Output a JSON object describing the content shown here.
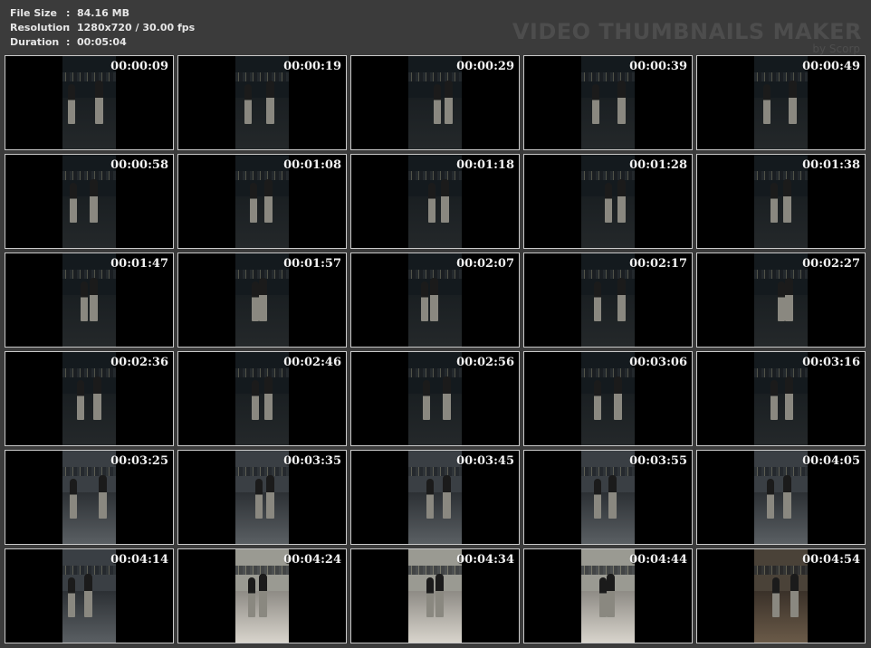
{
  "info": {
    "file_size_label": "File Size",
    "file_size_value": "84.16 MB",
    "resolution_label": "Resolution",
    "resolution_value": "1280x720 / 30.00 fps",
    "duration_label": "Duration",
    "duration_value": "00:05:04",
    "separator": ":"
  },
  "brand": {
    "title": "VIDEO THUMBNAILS MAKER",
    "subtitle": "by Scorp"
  },
  "thumbnails": [
    {
      "timestamp": "00:00:09"
    },
    {
      "timestamp": "00:00:19"
    },
    {
      "timestamp": "00:00:29"
    },
    {
      "timestamp": "00:00:39"
    },
    {
      "timestamp": "00:00:49"
    },
    {
      "timestamp": "00:00:58"
    },
    {
      "timestamp": "00:01:08"
    },
    {
      "timestamp": "00:01:18"
    },
    {
      "timestamp": "00:01:28"
    },
    {
      "timestamp": "00:01:38"
    },
    {
      "timestamp": "00:01:47"
    },
    {
      "timestamp": "00:01:57"
    },
    {
      "timestamp": "00:02:07"
    },
    {
      "timestamp": "00:02:17"
    },
    {
      "timestamp": "00:02:27"
    },
    {
      "timestamp": "00:02:36"
    },
    {
      "timestamp": "00:02:46"
    },
    {
      "timestamp": "00:02:56"
    },
    {
      "timestamp": "00:03:06"
    },
    {
      "timestamp": "00:03:16"
    },
    {
      "timestamp": "00:03:25"
    },
    {
      "timestamp": "00:03:35"
    },
    {
      "timestamp": "00:03:45"
    },
    {
      "timestamp": "00:03:55"
    },
    {
      "timestamp": "00:04:05"
    },
    {
      "timestamp": "00:04:14"
    },
    {
      "timestamp": "00:04:24"
    },
    {
      "timestamp": "00:04:34"
    },
    {
      "timestamp": "00:04:44"
    },
    {
      "timestamp": "00:04:54"
    }
  ]
}
